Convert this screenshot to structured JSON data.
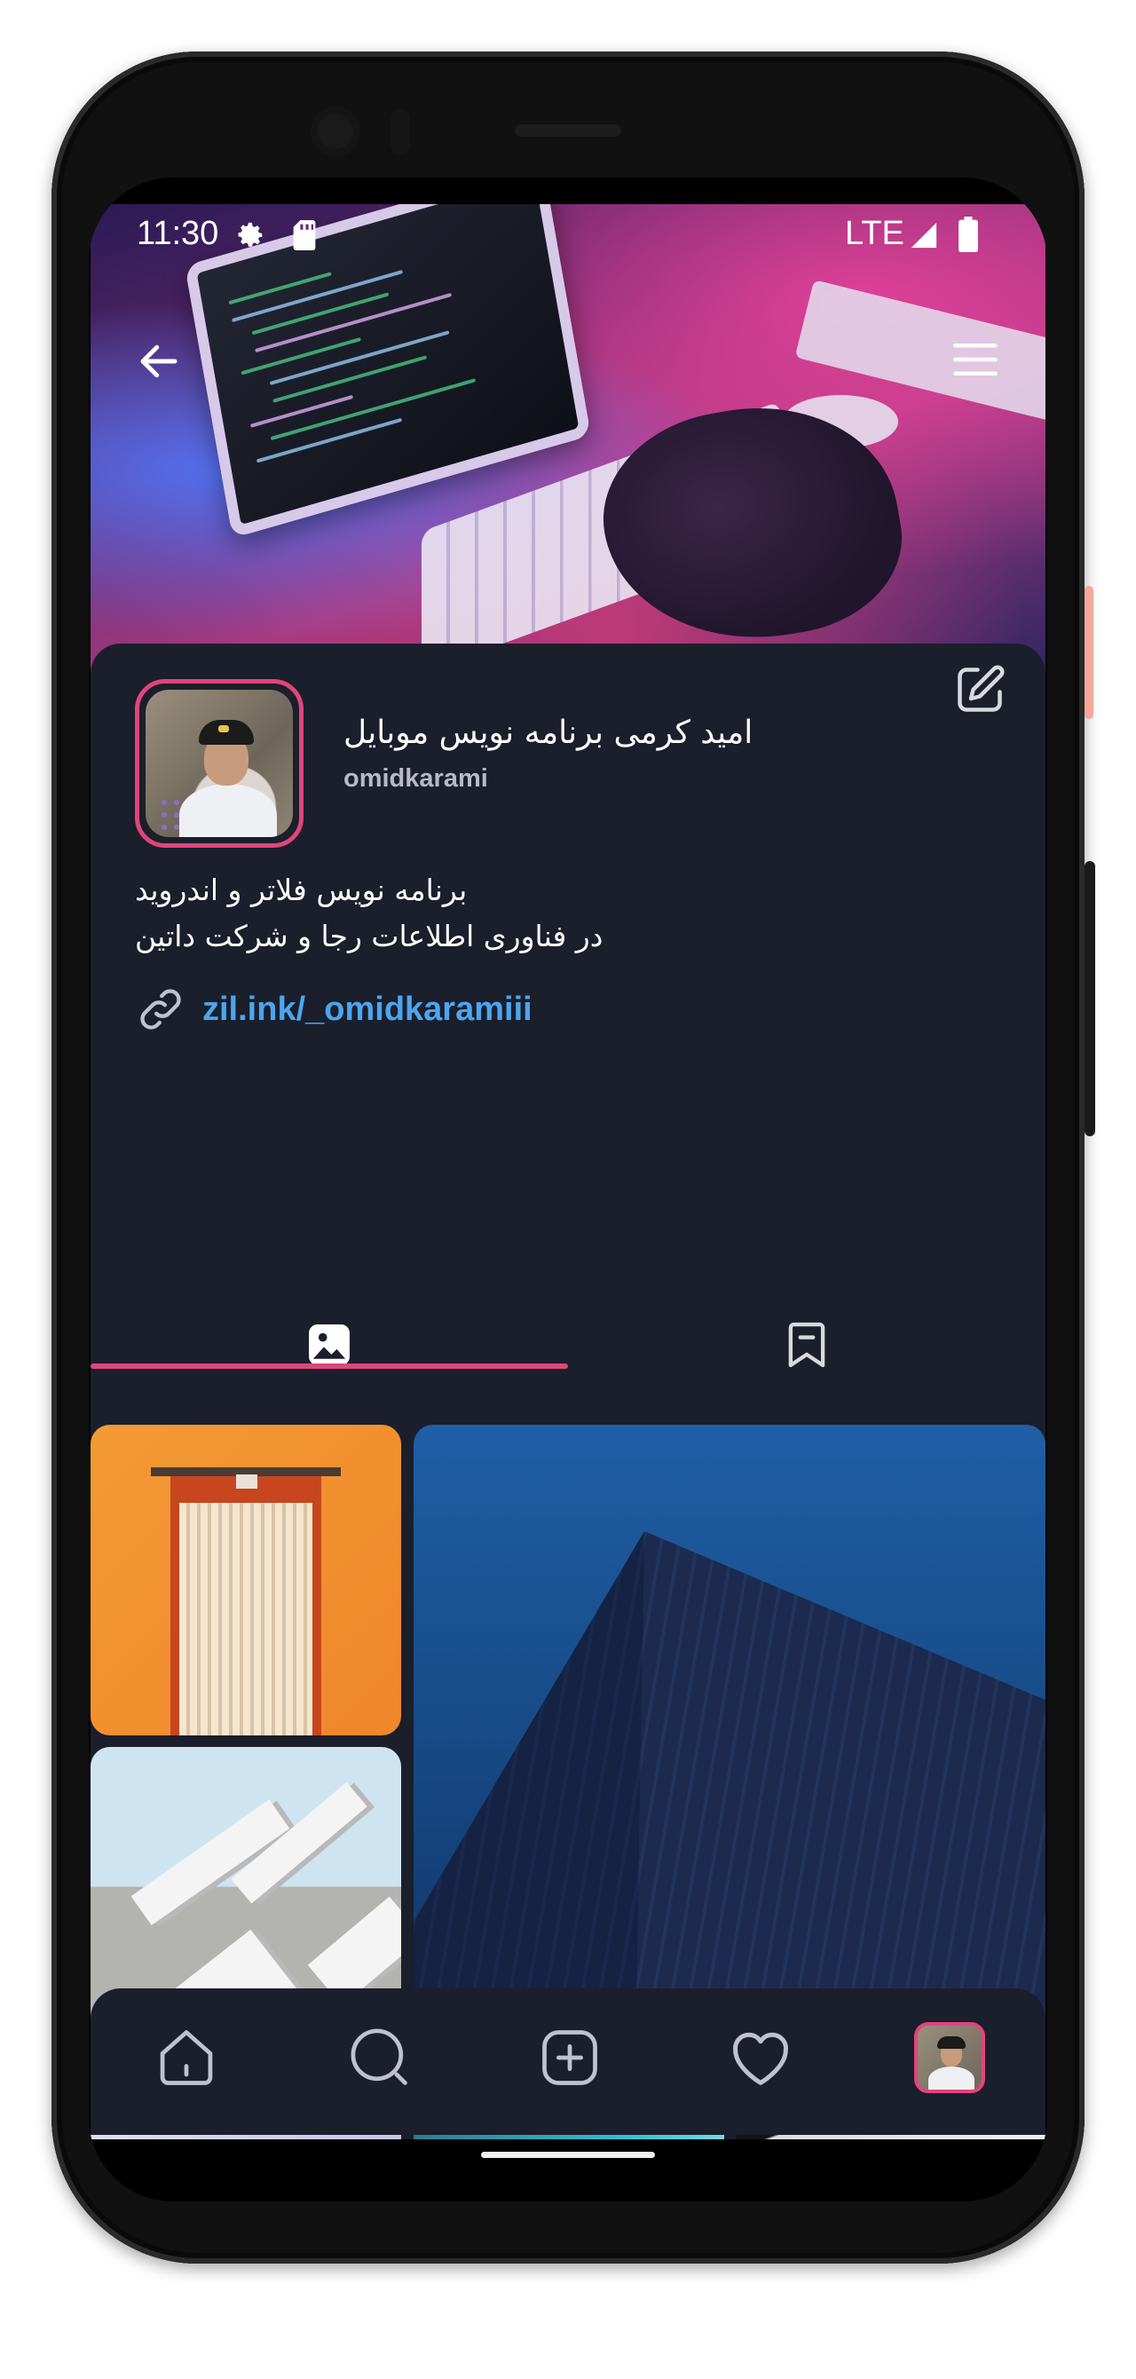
{
  "status_bar": {
    "time": "11:30",
    "network": "LTE",
    "icons": [
      "gear-icon",
      "sd-card-icon",
      "signal-icon",
      "battery-icon"
    ]
  },
  "header": {
    "back_icon": "arrow-left-icon",
    "menu_icon": "hamburger-menu-icon"
  },
  "profile": {
    "display_name": "امید کرمی برنامه نویس موبایل",
    "username": "omidkarami",
    "bio_lines": [
      "برنامه نویس فلاتر و اندروید",
      "در فناوری اطلاعات رجا و شرکت داتین"
    ],
    "link": "zil.ink/_omidkaramiii",
    "edit_icon": "edit-pencil-icon"
  },
  "tabs": [
    {
      "name": "posts",
      "icon": "image-icon",
      "active": true
    },
    {
      "name": "saved",
      "icon": "bookmark-icon",
      "active": false
    }
  ],
  "grid": [
    {
      "subject": "orange-door"
    },
    {
      "subject": "blue-building"
    },
    {
      "subject": "white-architecture"
    },
    {
      "subject": "lavender-abstract"
    },
    {
      "subject": "teal-building"
    },
    {
      "subject": "dark-white-curve"
    }
  ],
  "bottom_nav": [
    {
      "name": "home",
      "icon": "home-icon"
    },
    {
      "name": "search",
      "icon": "search-icon"
    },
    {
      "name": "add",
      "icon": "add-square-icon"
    },
    {
      "name": "likes",
      "icon": "heart-icon"
    },
    {
      "name": "profile",
      "icon": "avatar"
    }
  ],
  "colors": {
    "background": "#1b1e2b",
    "accent": "#e0457b",
    "link": "#4aa6f0",
    "text": "#ffffff",
    "muted_text": "#b7bac6"
  }
}
